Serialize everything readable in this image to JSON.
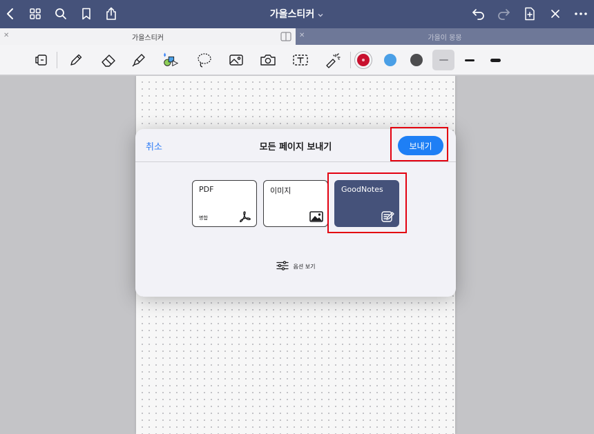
{
  "colors": {
    "nav_bar": "#45527a",
    "accent_blue": "#1e7ff5",
    "link_blue": "#2f7cf6",
    "highlight_red": "#e3000f",
    "goodnotes_tile": "#45527a"
  },
  "topbar": {
    "title": "가을스티커",
    "left_icons": [
      "back-chevron-icon",
      "grid-icon",
      "search-icon",
      "bookmark-icon",
      "share-icon"
    ],
    "right_icons": [
      "undo-icon",
      "redo-icon",
      "add-page-icon",
      "close-icon",
      "more-icon"
    ]
  },
  "tabs": [
    {
      "label": "가을스티커",
      "active": true
    },
    {
      "label": "가을이 몽몽",
      "active": false
    }
  ],
  "toolbar": {
    "tools": [
      "reading-mode-icon",
      "pen-icon",
      "eraser-icon",
      "highlighter-icon",
      "shape-icon",
      "lasso-icon",
      "image-icon",
      "camera-icon",
      "text-box-icon",
      "laser-pointer-icon"
    ],
    "colors": [
      {
        "name": "red",
        "hex": "#c8102e",
        "selected": true
      },
      {
        "name": "blue",
        "hex": "#4a9fe6",
        "selected": false
      },
      {
        "name": "dark-gray",
        "hex": "#4d4d4f",
        "selected": false
      }
    ],
    "strokes": [
      {
        "size": "thin",
        "selected": true
      },
      {
        "size": "medium",
        "selected": false
      },
      {
        "size": "thick",
        "selected": false
      }
    ]
  },
  "dialog": {
    "cancel": "취소",
    "title": "모든 페이지 보내기",
    "export": "보내기",
    "formats": [
      {
        "label": "PDF",
        "sub": "병합",
        "icon": "pdf-icon",
        "selected": false
      },
      {
        "label": "이미지",
        "sub": "",
        "icon": "image-icon",
        "selected": false
      },
      {
        "label": "GoodNotes",
        "sub": "",
        "icon": "goodnotes-icon",
        "selected": true
      }
    ],
    "options": "옵션 보기"
  }
}
